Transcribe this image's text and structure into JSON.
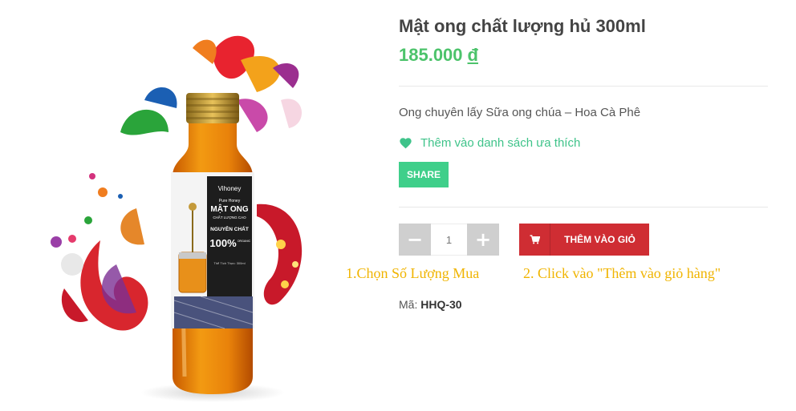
{
  "product": {
    "title": "Mật ong chất lượng hủ 300ml",
    "price": "185.000",
    "currency": "đ",
    "description": "Ong chuyên lấy Sữa ong chúa – Hoa Cà Phê",
    "sku_label": "Mã:",
    "sku_value": "HHQ-30"
  },
  "label_art": {
    "brand": "Vihoney",
    "line1": "Pure Honey",
    "line2": "MẬT ONG",
    "line3": "CHẤT LƯỢNG CAO",
    "line4": "NGUYÊN CHẤT",
    "line5": "100%",
    "line6": "ORGANIC",
    "line7": "Thể Tích Thực: 300ml"
  },
  "actions": {
    "wishlist_label": "Thêm vào danh sách ưa thích",
    "share_label": "SHARE",
    "qty_minus": "−",
    "qty_value": "1",
    "qty_plus": "+",
    "cart_label": "THÊM VÀO GIỎ"
  },
  "annotations": {
    "step1": "1.Chọn Số Lượng Mua",
    "step2": "2. Click vào \"Thêm vào giỏ hàng\""
  },
  "icons": {
    "wishlist": "heart-icon",
    "cart": "cart-icon"
  },
  "colors": {
    "price": "#4cc36b",
    "wishlist": "#3fc38a",
    "share": "#3fcf8a",
    "cart": "#cf2d33",
    "annotation": "#f0b400"
  }
}
